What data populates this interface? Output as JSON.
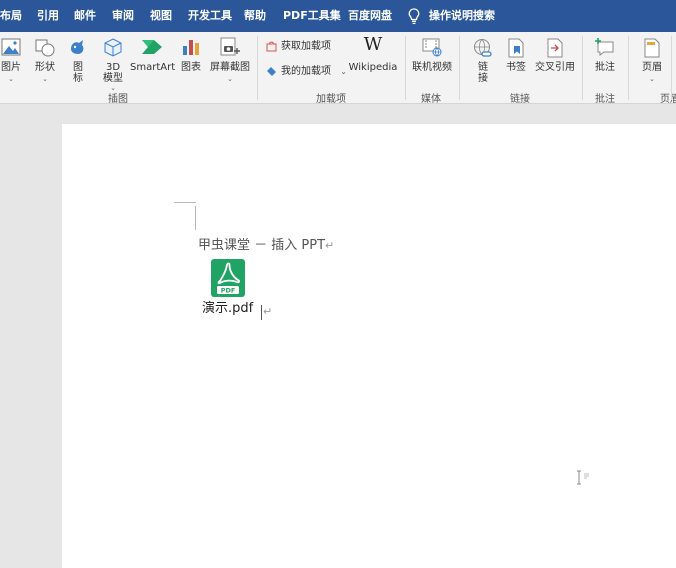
{
  "menu": {
    "items": [
      "布局",
      "引用",
      "邮件",
      "审阅",
      "视图",
      "开发工具",
      "帮助",
      "PDF工具集",
      "百度网盘"
    ],
    "tell_me": "操作说明搜索"
  },
  "ribbon": {
    "illustrations": {
      "picture": "图片",
      "shapes": "形状",
      "icons_line1": "图",
      "icons_line2": "标",
      "model3d_line1": "3D",
      "model3d_line2": "模型",
      "smartart": "SmartArt",
      "chart": "图表",
      "screenshot": "屏幕截图",
      "group_label": "插图"
    },
    "addins": {
      "get_addins": "获取加载项",
      "my_addins": "我的加载项",
      "wikipedia": "Wikipedia",
      "group_label": "加载项"
    },
    "media": {
      "online_video": "联机视频",
      "group_label": "媒体"
    },
    "links": {
      "link_line1": "链",
      "link_line2": "接",
      "bookmark": "书签",
      "cross_ref": "交叉引用",
      "group_label": "链接"
    },
    "comments": {
      "comment": "批注",
      "group_label": "批注"
    },
    "header_footer": {
      "header": "页眉",
      "group_label": "页眉"
    }
  },
  "document": {
    "title_line": "甲虫课堂 － 插入 PPT",
    "paragraph_mark": "↵",
    "attachment_name": "演示.pdf",
    "attachment_icon_text": "PDF"
  },
  "colors": {
    "menubar_bg": "#2b579a",
    "ribbon_bg": "#f3f3f3",
    "pdf_icon": "#21a366",
    "workspace_bg": "#e6e6e6"
  }
}
